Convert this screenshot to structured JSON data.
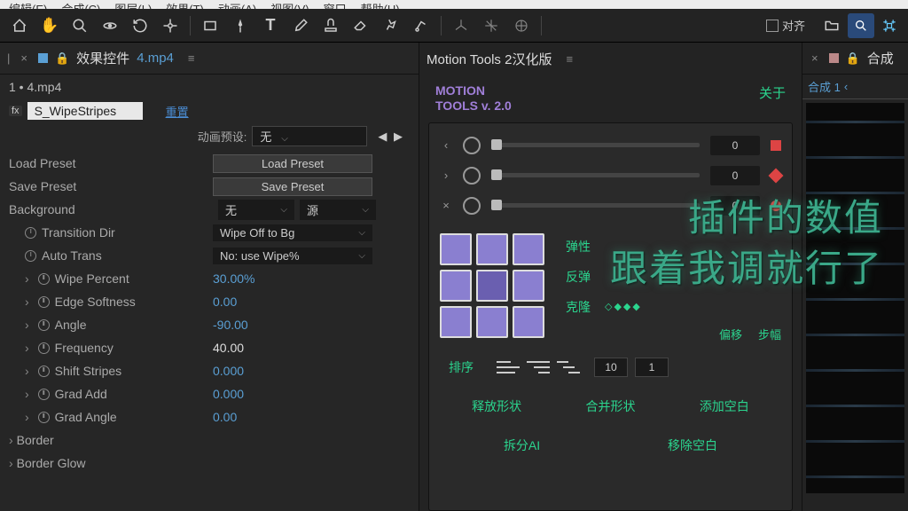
{
  "menubar": [
    "编辑(E)",
    "合成(C)",
    "图层(L)",
    "效果(T)",
    "动画(A)",
    "视图(V)",
    "窗口",
    "帮助(H)"
  ],
  "toolbar": {
    "align": "对齐"
  },
  "effects_panel": {
    "tab_title": "效果控件",
    "tab_file": "4.mp4",
    "breadcrumb": "1 • 4.mp4",
    "effect_name": "S_WipeStripes",
    "reset": "重置",
    "anim_preset_label": "动画预设:",
    "anim_preset_value": "无",
    "props": {
      "load_preset": "Load Preset",
      "load_preset_btn": "Load Preset",
      "save_preset": "Save Preset",
      "save_preset_btn": "Save Preset",
      "background": "Background",
      "bg_val": "无",
      "bg_src": "源",
      "transition_dir": "Transition Dir",
      "transition_dir_val": "Wipe Off to Bg",
      "auto_trans": "Auto Trans",
      "auto_trans_val": "No: use Wipe%",
      "wipe_percent": "Wipe Percent",
      "wipe_percent_val": "30.00%",
      "edge_softness": "Edge Softness",
      "edge_softness_val": "0.00",
      "angle": "Angle",
      "angle_val": "-90.00",
      "frequency": "Frequency",
      "frequency_val": "40.00",
      "shift_stripes": "Shift Stripes",
      "shift_stripes_val": "0.000",
      "grad_add": "Grad Add",
      "grad_add_val": "0.000",
      "grad_angle": "Grad Angle",
      "grad_angle_val": "0.00",
      "border": "Border",
      "border_glow": "Border Glow"
    }
  },
  "motion_tools": {
    "tab_title": "Motion Tools 2汉化版",
    "title_l1": "MOTION",
    "title_l2": "TOOLS v. 2.0",
    "about": "关于",
    "ease_in_val": "0",
    "ease_out_val": "0",
    "ease_both_val": "0",
    "elastic": "弹性",
    "bounce": "反弹",
    "clone": "克隆",
    "offset": "偏移",
    "step": "步幅",
    "sequence": "排序",
    "seq_num1": "10",
    "seq_num2": "1",
    "release_shape": "释放形状",
    "merge_shape": "合并形状",
    "add_blank": "添加空白",
    "split_ai": "拆分AI",
    "remove_blank": "移除空白"
  },
  "comp_panel": {
    "tab_title": "合成",
    "comp_name": "合成 1"
  },
  "subtitle": {
    "line1": "插件的数值",
    "line2": "跟着我调就行了"
  }
}
